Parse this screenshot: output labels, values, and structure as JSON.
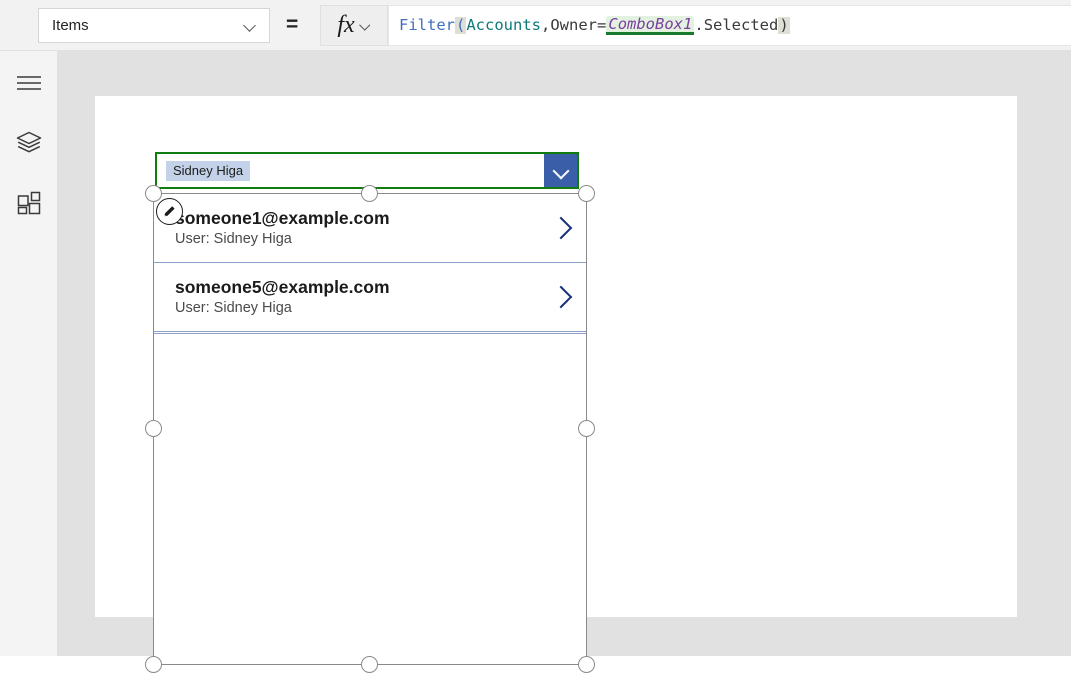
{
  "formula_bar": {
    "property_label": "Items",
    "equals": "=",
    "fx_label": "fx",
    "formula_plain": "Filter( Accounts, Owner = ComboBox1.Selected )",
    "tokens": {
      "fn": "Filter",
      "open_paren": "(",
      "table": " Accounts",
      "comma": ", ",
      "field": "Owner",
      "operator": " = ",
      "control": "ComboBox1",
      "dot_property": ".Selected ",
      "close_paren": ")"
    }
  },
  "sidebar": {
    "items": [
      {
        "name": "hamburger-menu",
        "icon": "hamburger-icon"
      },
      {
        "name": "tree-view",
        "icon": "layers-icon"
      },
      {
        "name": "insert",
        "icon": "grid-insert-icon"
      }
    ]
  },
  "canvas": {
    "combobox": {
      "selected_value": "Sidney Higa",
      "chevron_icon": "chevron-down-icon",
      "toggle_color": "#3a5fa8",
      "selection_border_color": "#107c10"
    },
    "gallery": {
      "edit_badge_icon": "pencil-edit-icon",
      "separator_color": "#8e9ecb",
      "arrow_color": "#16307c",
      "items": [
        {
          "title": "someone1@example.com",
          "subtitle": "User: Sidney Higa",
          "arrow_icon": "chevron-right-icon"
        },
        {
          "title": "someone5@example.com",
          "subtitle": "User: Sidney Higa",
          "arrow_icon": "chevron-right-icon"
        }
      ]
    }
  }
}
